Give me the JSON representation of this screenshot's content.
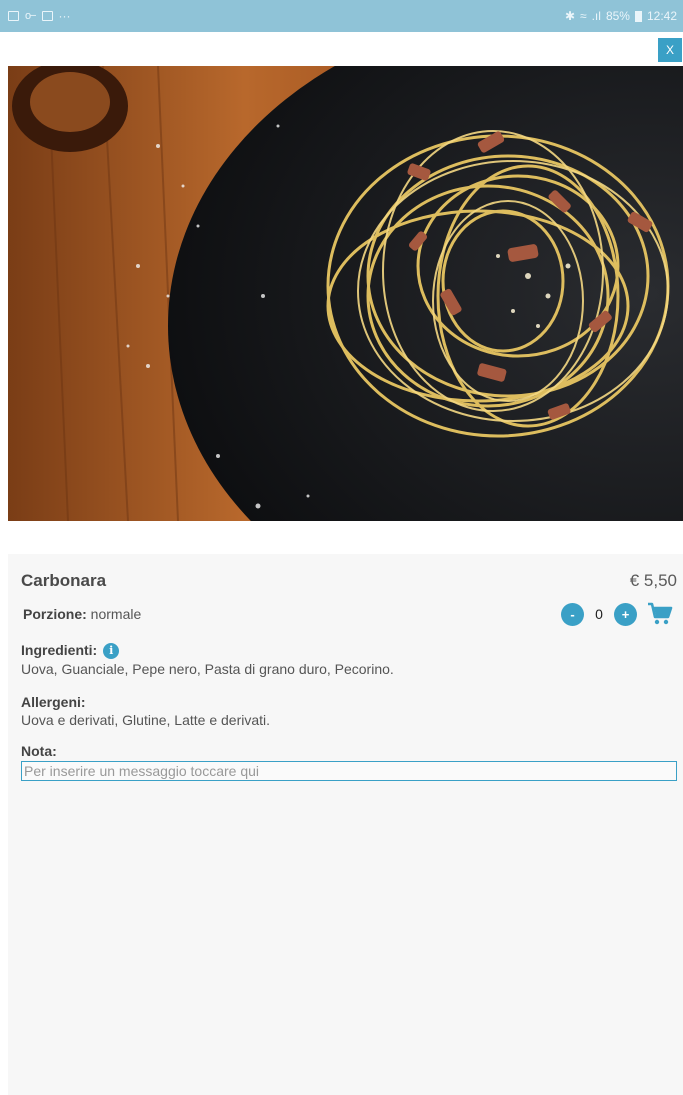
{
  "status_bar": {
    "more": "···",
    "battery": "85%",
    "time": "12:42"
  },
  "close_label": "X",
  "dish": {
    "name": "Carbonara",
    "price": "€ 5,50",
    "portion_label": "Porzione:",
    "portion_value": "normale",
    "quantity": "0",
    "minus_label": "-",
    "plus_label": "+",
    "ingredients_label": "Ingredienti:",
    "ingredients_info": "i",
    "ingredients": "Uova, Guanciale, Pepe nero, Pasta di grano duro, Pecorino.",
    "allergens_label": "Allergeni:",
    "allergens": "Uova e derivati, Glutine, Latte e derivati.",
    "note_label": "Nota:",
    "note_placeholder": "Per inserire un messaggio toccare qui"
  },
  "colors": {
    "accent": "#3aa0c6",
    "status_bar": "#8fc3d7",
    "panel": "#f7f7f7"
  },
  "icons": [
    "image-icon",
    "key-icon",
    "mail-icon",
    "bluetooth-icon",
    "wifi-icon",
    "signal-icon",
    "battery-icon",
    "info-icon",
    "cart-icon"
  ]
}
